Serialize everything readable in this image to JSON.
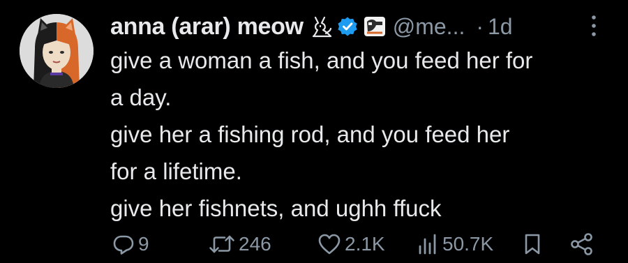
{
  "tweet": {
    "display_name": "anna (arar) meow",
    "handle": "@me...",
    "separator": "·",
    "time": "1d",
    "lines": [
      "give a woman a fish, and you feed her for",
      "a day.",
      "give her a fishing rod, and you feed her",
      "for a lifetime.",
      "give her fishnets, and ughh ffuck"
    ],
    "icons": {
      "name_emoji": "cat-outline-icon",
      "verified": "verified-badge-icon",
      "org_badge": "org-badge-icon",
      "more": "more-options-icon"
    }
  },
  "actions": {
    "replies": "9",
    "reposts": "246",
    "likes": "2.1K",
    "views": "50.7K",
    "icons": [
      "reply-icon",
      "repost-icon",
      "like-icon",
      "views-icon",
      "bookmark-icon",
      "share-icon"
    ]
  },
  "colors": {
    "background": "#000000",
    "text_primary": "#e7e9ea",
    "text_secondary": "#8b98a5",
    "verified_blue": "#1d9bf0"
  }
}
